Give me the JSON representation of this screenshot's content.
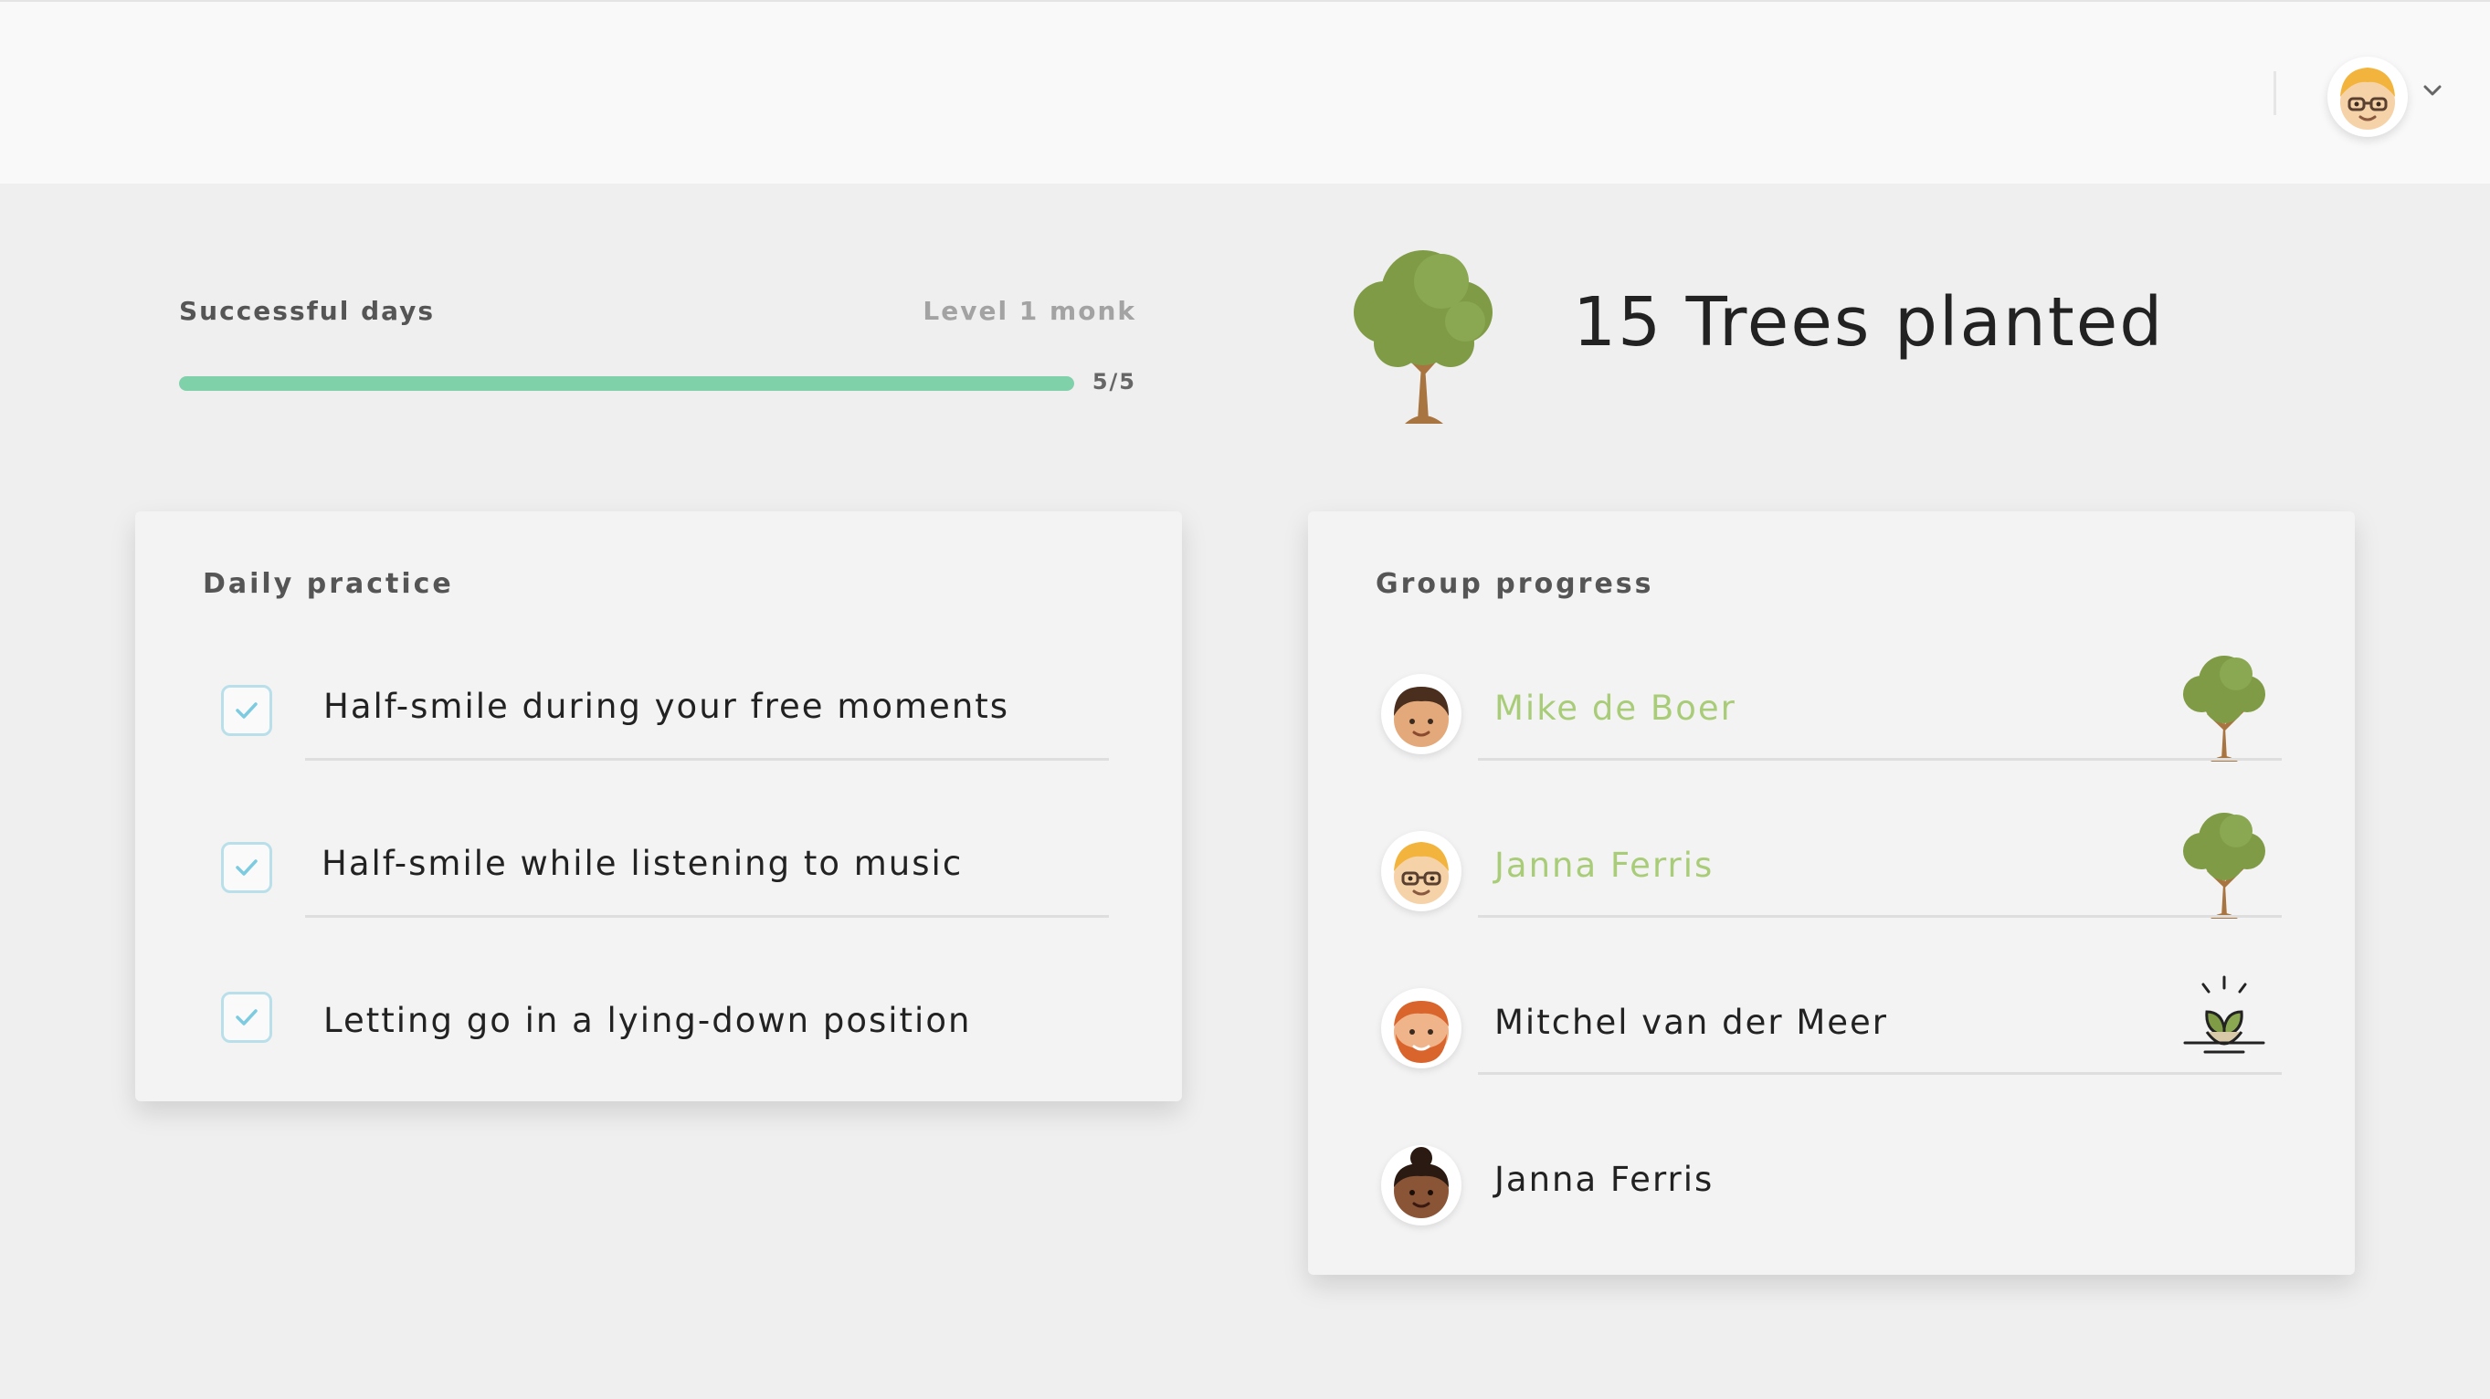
{
  "header": {
    "user_avatar_icon": "user-avatar-blonde-glasses-icon",
    "menu_icon": "chevron-down-icon"
  },
  "progress": {
    "label": "Successful days",
    "level": "Level 1 monk",
    "count": "5/5",
    "value": 5,
    "max": 5,
    "fill_color": "#7fd1aa"
  },
  "trees": {
    "title": "15 Trees planted",
    "icon": "tree-icon"
  },
  "daily_practice": {
    "title": "Daily practice",
    "items": [
      {
        "label": "Half-smile during your free moments",
        "checked": true
      },
      {
        "label": "Half-smile while listening to music",
        "checked": true
      },
      {
        "label": "Letting go in a lying-down position",
        "checked": true
      }
    ]
  },
  "group_progress": {
    "title": "Group progress",
    "members": [
      {
        "name": "Mike de Boer",
        "avatar": "avatar-boy-dark-hair-icon",
        "status": "tree-icon",
        "highlight": true
      },
      {
        "name": "Janna Ferris",
        "avatar": "avatar-blonde-glasses-icon",
        "status": "tree-icon",
        "highlight": true
      },
      {
        "name": "Mitchel van der Meer",
        "avatar": "avatar-red-beard-icon",
        "status": "sprout-icon",
        "highlight": false
      },
      {
        "name": "Janna Ferris",
        "avatar": "avatar-dark-skin-bun-icon",
        "status": "",
        "highlight": false
      }
    ],
    "highlight_color": "#a9cc78",
    "default_color": "#222222"
  },
  "colors": {
    "checkbox_border": "#b9e0ea",
    "check_mark": "#7ccbe0",
    "tree_foliage": "#7f9b46",
    "tree_trunk": "#a8743f"
  }
}
